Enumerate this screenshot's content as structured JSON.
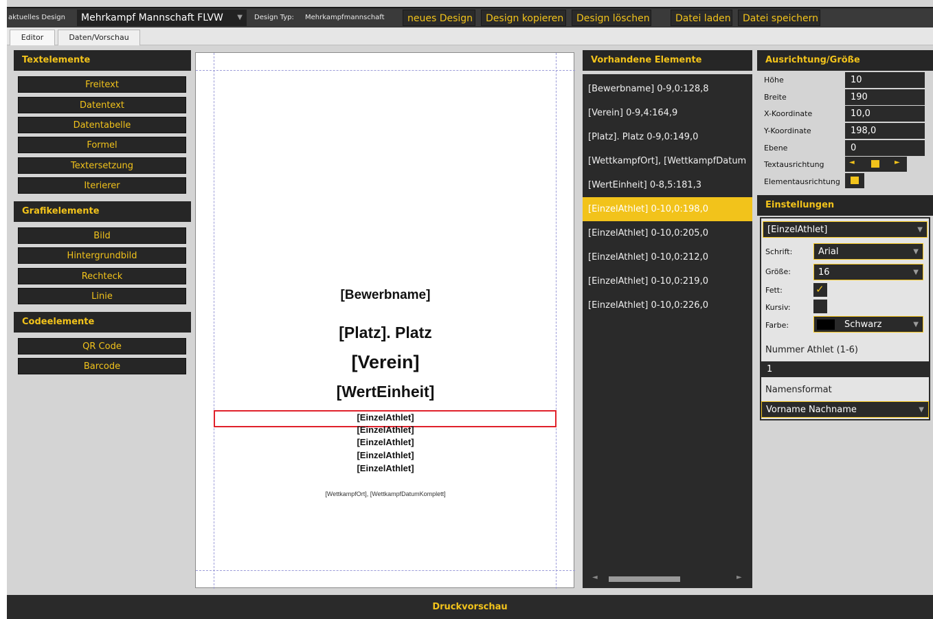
{
  "topbar": {
    "current_design_label": "aktuelles Design",
    "current_design_value": "Mehrkampf Mannschaft FLVW",
    "design_type_label": "Design Typ:",
    "design_type_value": "Mehrkampfmannschaft",
    "buttons": [
      "neues Design",
      "Design kopieren",
      "Design löschen",
      "Datei laden",
      "Datei speichern"
    ]
  },
  "tabs": [
    "Editor",
    "Daten/Vorschau"
  ],
  "left": {
    "text_header": "Textelemente",
    "text_buttons": [
      "Freitext",
      "Datentext",
      "Datentabelle",
      "Formel",
      "Textersetzung",
      "Iterierer"
    ],
    "graphic_header": "Grafikelemente",
    "graphic_buttons": [
      "Bild",
      "Hintergrundbild",
      "Rechteck",
      "Linie"
    ],
    "code_header": "Codeelemente",
    "code_buttons": [
      "QR Code",
      "Barcode"
    ]
  },
  "canvas": {
    "bewerbname": "[Bewerbname]",
    "platz": "[Platz]. Platz",
    "verein": "[Verein]",
    "werteinheit": "[WertEinheit]",
    "athletes": [
      "[EinzelAthlet]",
      "[EinzelAthlet]",
      "[EinzelAthlet]",
      "[EinzelAthlet]",
      "[EinzelAthlet]"
    ],
    "footer": "[WettkampfOrt], [WettkampfDatumKomplett]"
  },
  "elements": {
    "header": "Vorhandene Elemente",
    "items": [
      "[Bewerbname] 0-9,0:128,8",
      "[Verein] 0-9,4:164,9",
      "[Platz]. Platz 0-9,0:149,0",
      "[WettkampfOrt], [WettkampfDatum",
      "[WertEinheit] 0-8,5:181,3",
      "[EinzelAthlet] 0-10,0:198,0",
      "[EinzelAthlet] 0-10,0:205,0",
      "[EinzelAthlet] 0-10,0:212,0",
      "[EinzelAthlet] 0-10,0:219,0",
      "[EinzelAthlet] 0-10,0:226,0"
    ],
    "selected_index": 5
  },
  "alignment": {
    "header": "Ausrichtung/Größe",
    "hoehe_label": "Höhe",
    "hoehe": "10",
    "breite_label": "Breite",
    "breite": "190",
    "x_label": "X-Koordinate",
    "x": "10,0",
    "y_label": "Y-Koordinate",
    "y": "198,0",
    "ebene_label": "Ebene",
    "ebene": "0",
    "textausrichtung_label": "Textausrichtung",
    "elementausrichtung_label": "Elementausrichtung"
  },
  "settings": {
    "header": "Einstellungen",
    "type": "[EinzelAthlet]",
    "schrift_label": "Schrift:",
    "schrift": "Arial",
    "groesse_label": "Größe:",
    "groesse": "16",
    "fett_label": "Fett:",
    "fett": true,
    "kursiv_label": "Kursiv:",
    "kursiv": false,
    "farbe_label": "Farbe:",
    "farbe": "Schwarz",
    "nummer_label": "Nummer Athlet (1-6)",
    "nummer": "1",
    "namensformat_label": "Namensformat",
    "namensformat": "Vorname Nachname"
  },
  "bottom": {
    "label": "Druckvorschau"
  },
  "colors": {
    "accent": "#f2c31b",
    "dark": "#262626",
    "selection_border": "#e0202a"
  }
}
